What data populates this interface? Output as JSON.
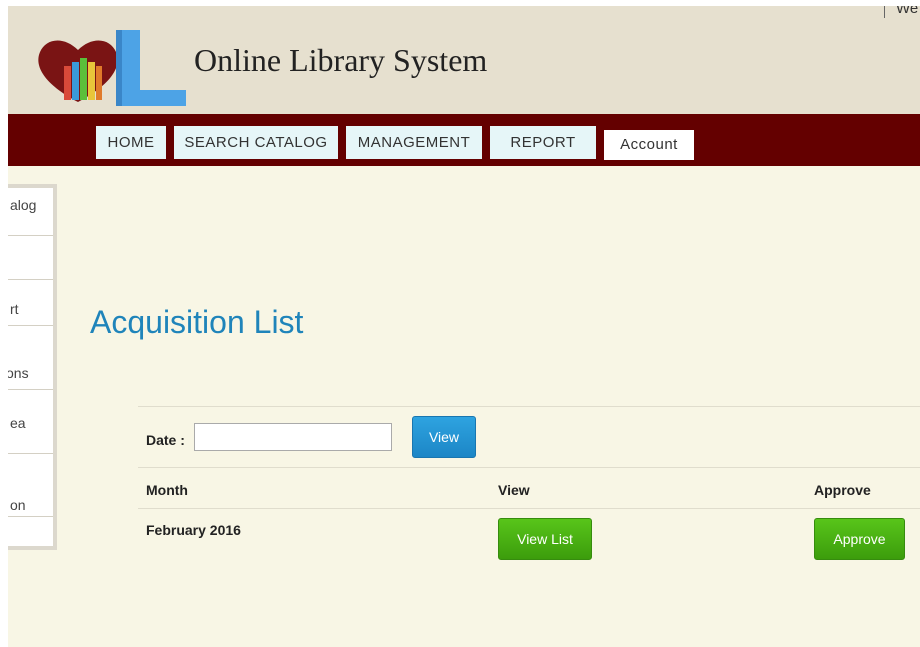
{
  "header": {
    "site_title": "Online Library System",
    "welcome_text": "We"
  },
  "nav": [
    {
      "label": "HOME"
    },
    {
      "label": "SEARCH CATALOG"
    },
    {
      "label": "MANAGEMENT"
    },
    {
      "label": "REPORT"
    },
    {
      "label": "Account"
    }
  ],
  "sidebar": {
    "items": [
      {
        "label": "alog"
      },
      {
        "label": ""
      },
      {
        "label": "rt"
      },
      {
        "label": "ons"
      },
      {
        "label": "ea"
      },
      {
        "label": ""
      },
      {
        "label": "on"
      }
    ]
  },
  "main": {
    "title": "Acquisition List",
    "date_label": "Date :",
    "date_value": "",
    "view_button": "View",
    "table": {
      "headers": [
        "Month",
        "View",
        "Approve"
      ],
      "rows": [
        {
          "month": "February 2016",
          "view_label": "View List",
          "approve_label": "Approve"
        }
      ]
    }
  },
  "colors": {
    "nav_bar": "#640000",
    "header_bg": "#e6e0cf",
    "page_bg": "#f8f6e5",
    "title_blue": "#1f84ba",
    "button_green": "#4cae14",
    "button_blue": "#2496d6"
  }
}
